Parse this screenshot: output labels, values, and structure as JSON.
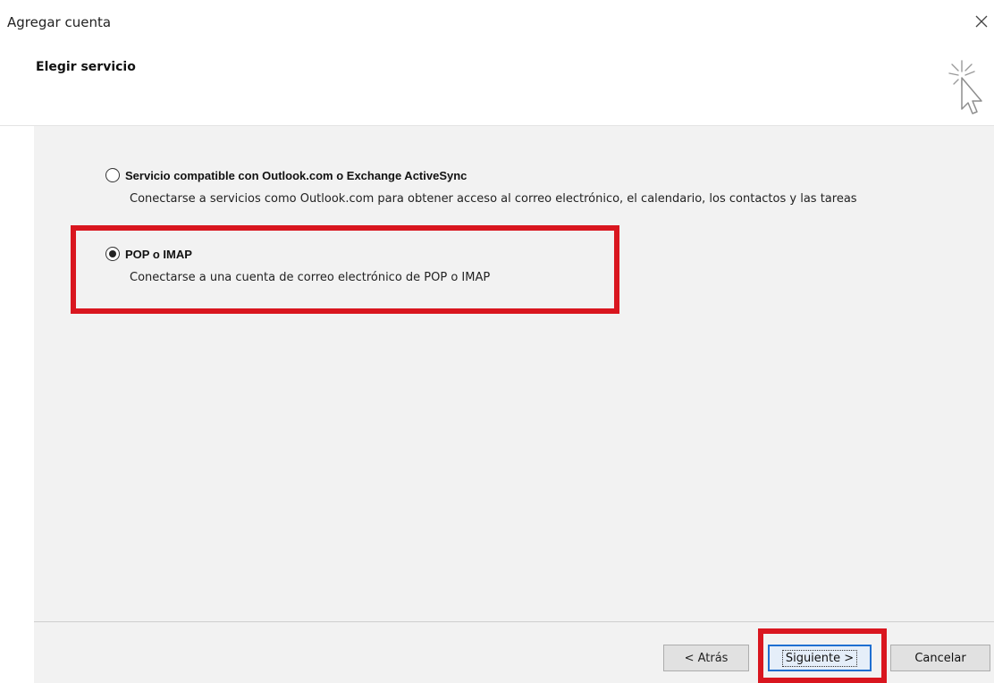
{
  "window": {
    "title": "Agregar cuenta",
    "close_glyph": "✕"
  },
  "header": {
    "section_title": "Elegir servicio",
    "icon": "wizard-cursor-icon"
  },
  "options": [
    {
      "label": "Servicio compatible con Outlook.com o Exchange ActiveSync",
      "description": "Conectarse a servicios como Outlook.com para obtener acceso al correo electrónico, el calendario, los contactos y las tareas",
      "selected": false
    },
    {
      "label": "POP o IMAP",
      "description": "Conectarse a una cuenta de correo electrónico de POP o IMAP",
      "selected": true
    }
  ],
  "footer": {
    "back_label": "< Atrás",
    "next_label": "Siguiente >",
    "cancel_label": "Cancelar"
  },
  "colors": {
    "highlight": "#d9161f",
    "content_bg": "#f2f2f2",
    "focus_blue": "#1f6fd1"
  }
}
